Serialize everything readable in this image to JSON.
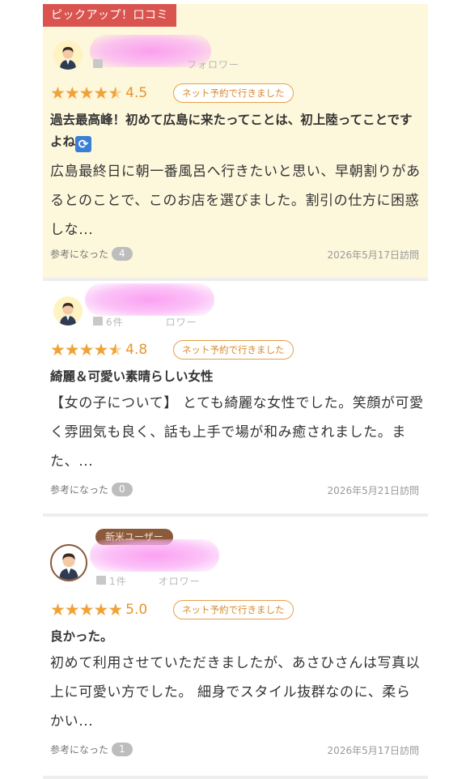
{
  "pickup_label": "ピックアップ！口コミ",
  "reviews": [
    {
      "follow_text": "フォロワー",
      "rating": "4.5",
      "tag": "ネット予約で行きました",
      "title": "過去最高峰！初めて広島に来たってことは、初上陸ってことですよね",
      "body": "広島最終日に朝一番風呂へ行きたいと思い、早朝割りがあるとのことで、このお店を選びました。割引の仕方に困惑しな...",
      "helpful_label": "参考になった",
      "helpful_count": "4",
      "visit_date": "2026年5月17日訪問"
    },
    {
      "follow_text": "6件　　　　ロワー",
      "rating": "4.8",
      "tag": "ネット予約で行きました",
      "title": "綺麗＆可愛い素晴らしい女性",
      "body": "【女の子について】 とても綺麗な女性でした。笑顔が可愛く雰囲気も良く、話も上手で場が和み癒されました。また、...",
      "helpful_label": "参考になった",
      "helpful_count": "0",
      "visit_date": "2026年5月21日訪問"
    },
    {
      "badge": "新米ユーザー",
      "follow_text": "1件　　　オロワー",
      "rating": "5.0",
      "tag": "ネット予約で行きました",
      "title": "良かった。",
      "body": "初めて利用させていただきましたが、あさひさんは写真以上に可愛い方でした。 細身でスタイル抜群なのに、柔らかい...",
      "helpful_label": "参考になった",
      "helpful_count": "1",
      "visit_date": "2026年5月17日訪問"
    }
  ],
  "colors": {
    "star": "#f0a236",
    "pickup_bg": "#d9534f",
    "highlight_bg": "#fdf7dc",
    "badge_bg": "#8b5a3b"
  }
}
